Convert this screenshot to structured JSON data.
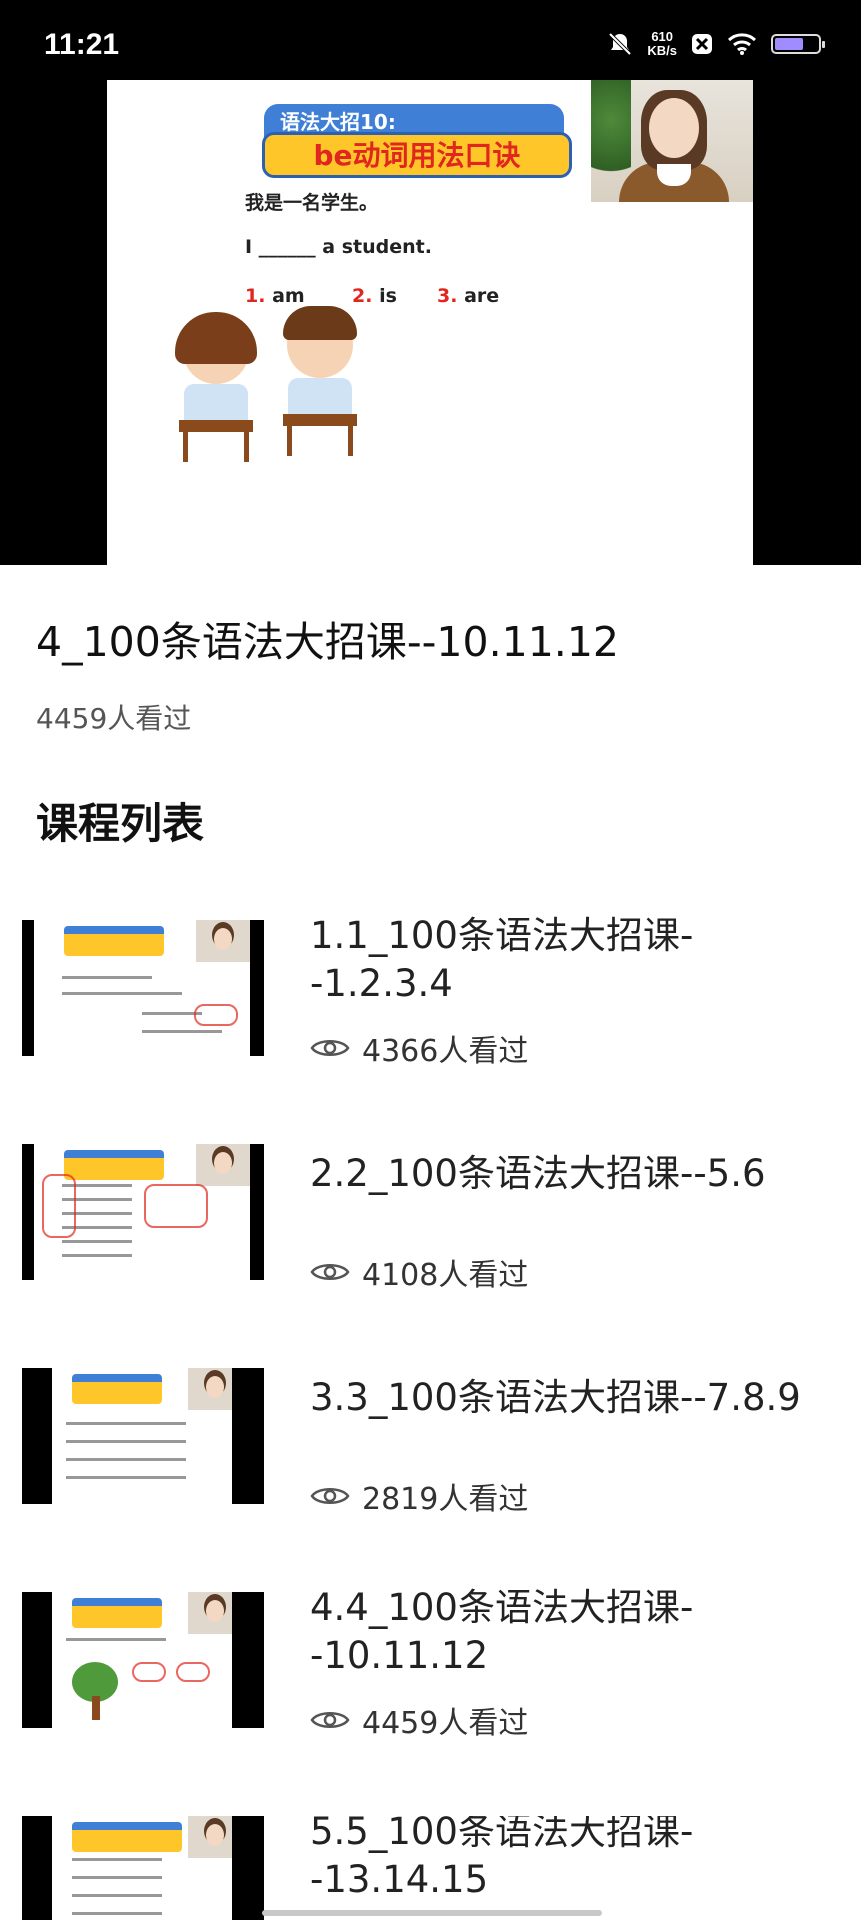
{
  "status_bar": {
    "time": "11:21",
    "net_speed_value": "610",
    "net_speed_unit": "KB/s",
    "icons": [
      "mute-bell-icon",
      "close-box-icon",
      "wifi-icon",
      "battery-icon"
    ]
  },
  "player": {
    "slide": {
      "banner_top": "语法大招10:",
      "banner_main": "be动词用法口诀",
      "sentence_cn": "我是一名学生。",
      "sentence_en": "I ______ a student.",
      "options": [
        {
          "num": "1.",
          "text": "am"
        },
        {
          "num": "2.",
          "text": "is"
        },
        {
          "num": "3.",
          "text": "are"
        }
      ]
    }
  },
  "video": {
    "title": "4_100条语法大招课--10.11.12",
    "views": "4459人看过"
  },
  "course_list": {
    "heading": "课程列表",
    "items": [
      {
        "title": "1.1_100条语法大招课--1.2.3.4",
        "views": "4366人看过"
      },
      {
        "title": "2.2_100条语法大招课--5.6",
        "views": "4108人看过"
      },
      {
        "title": "3.3_100条语法大招课--7.8.9",
        "views": "2819人看过"
      },
      {
        "title": "4.4_100条语法大招课--10.11.12",
        "views": "4459人看过"
      },
      {
        "title": "5.5_100条语法大招课--13.14.15",
        "views": ""
      }
    ]
  }
}
